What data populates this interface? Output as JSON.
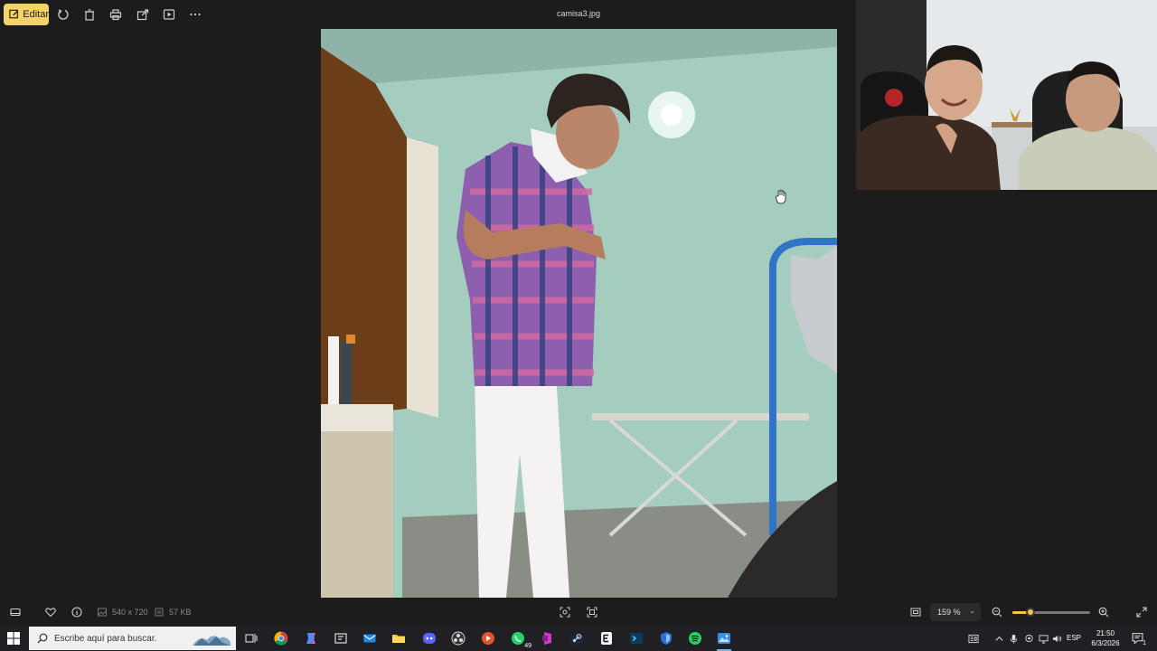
{
  "toolbar": {
    "edit_label": "Editar",
    "file_name": "camisa3.jpg"
  },
  "footer": {
    "dimensions": "540 x 720",
    "file_size": "57 KB",
    "zoom": "159 %",
    "zoom_slider_level": 0.23
  },
  "taskbar": {
    "search_placeholder": "Escribe aquí para buscar.",
    "whatsapp_badge": "49",
    "language": "ESP",
    "time": "21:50",
    "date": "6/3/2026",
    "notification_count": "1"
  },
  "colors": {
    "accent": "#f3d36a",
    "slider": "#f3c544",
    "taskbar_bg": "#1f1f24",
    "viewer_bg": "#1c1c1c"
  }
}
